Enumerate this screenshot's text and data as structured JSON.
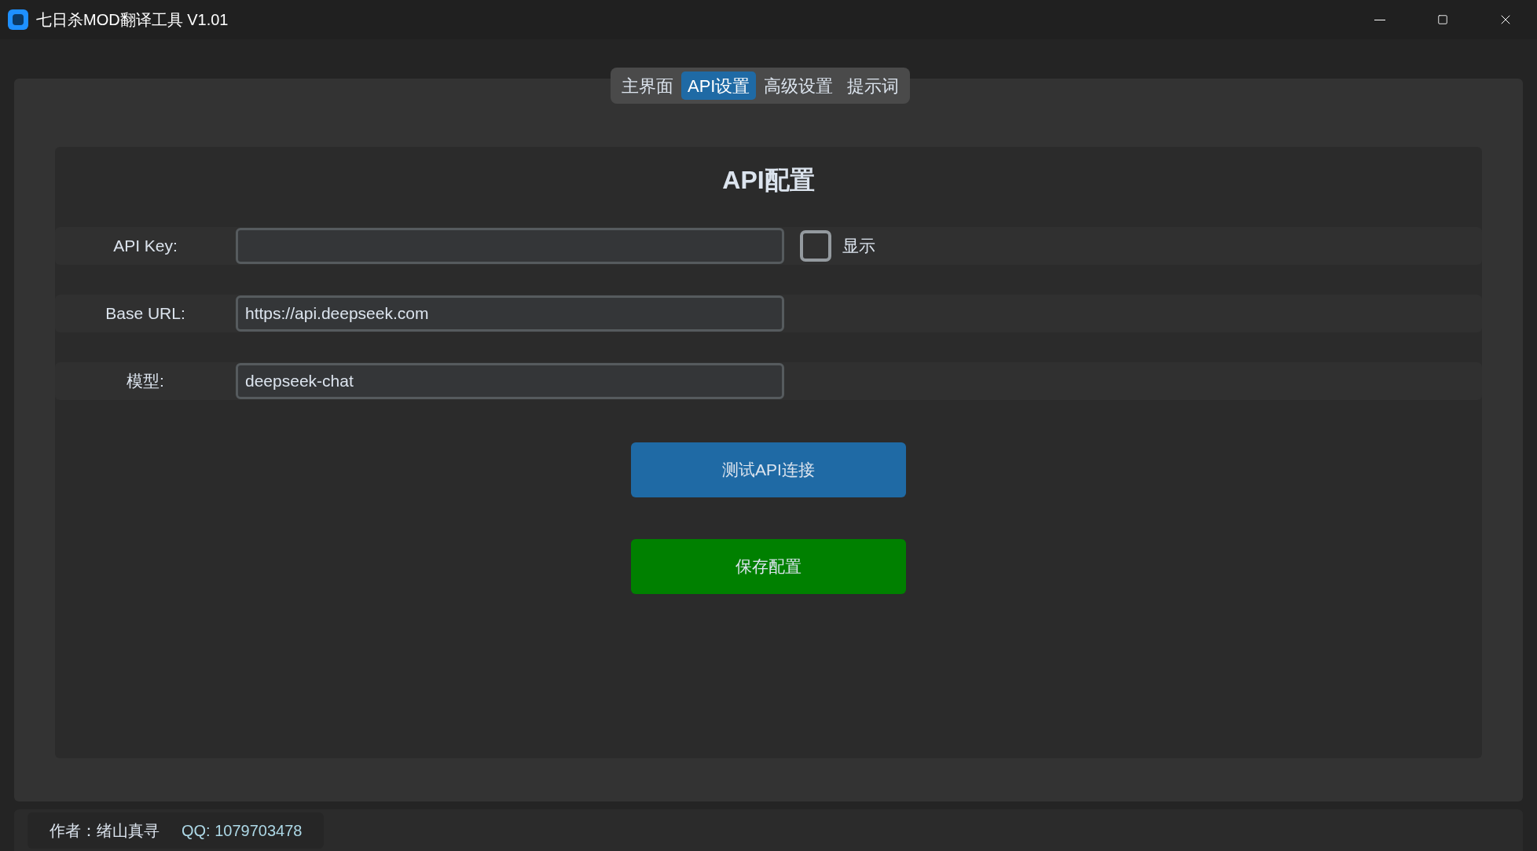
{
  "window": {
    "title": "七日杀MOD翻译工具 V1.01"
  },
  "tabs": [
    {
      "label": "主界面",
      "selected": false
    },
    {
      "label": "API设置",
      "selected": true
    },
    {
      "label": "高级设置",
      "selected": false
    },
    {
      "label": "提示词",
      "selected": false
    }
  ],
  "section_title": "API配置",
  "fields": [
    {
      "label": "API Key:",
      "show_toggle": {
        "label": "显示",
        "checked": false
      }
    },
    {
      "label": "Base URL:",
      "value": "https://api.deepseek.com"
    },
    {
      "label": "模型:",
      "value": "deepseek-chat"
    }
  ],
  "buttons": [
    {
      "label": "测试API连接",
      "kind": "primary"
    },
    {
      "label": "保存配置",
      "kind": "success"
    }
  ],
  "footer": {
    "author": "作者：绪山真寻",
    "contact": "QQ: 1079703478"
  }
}
